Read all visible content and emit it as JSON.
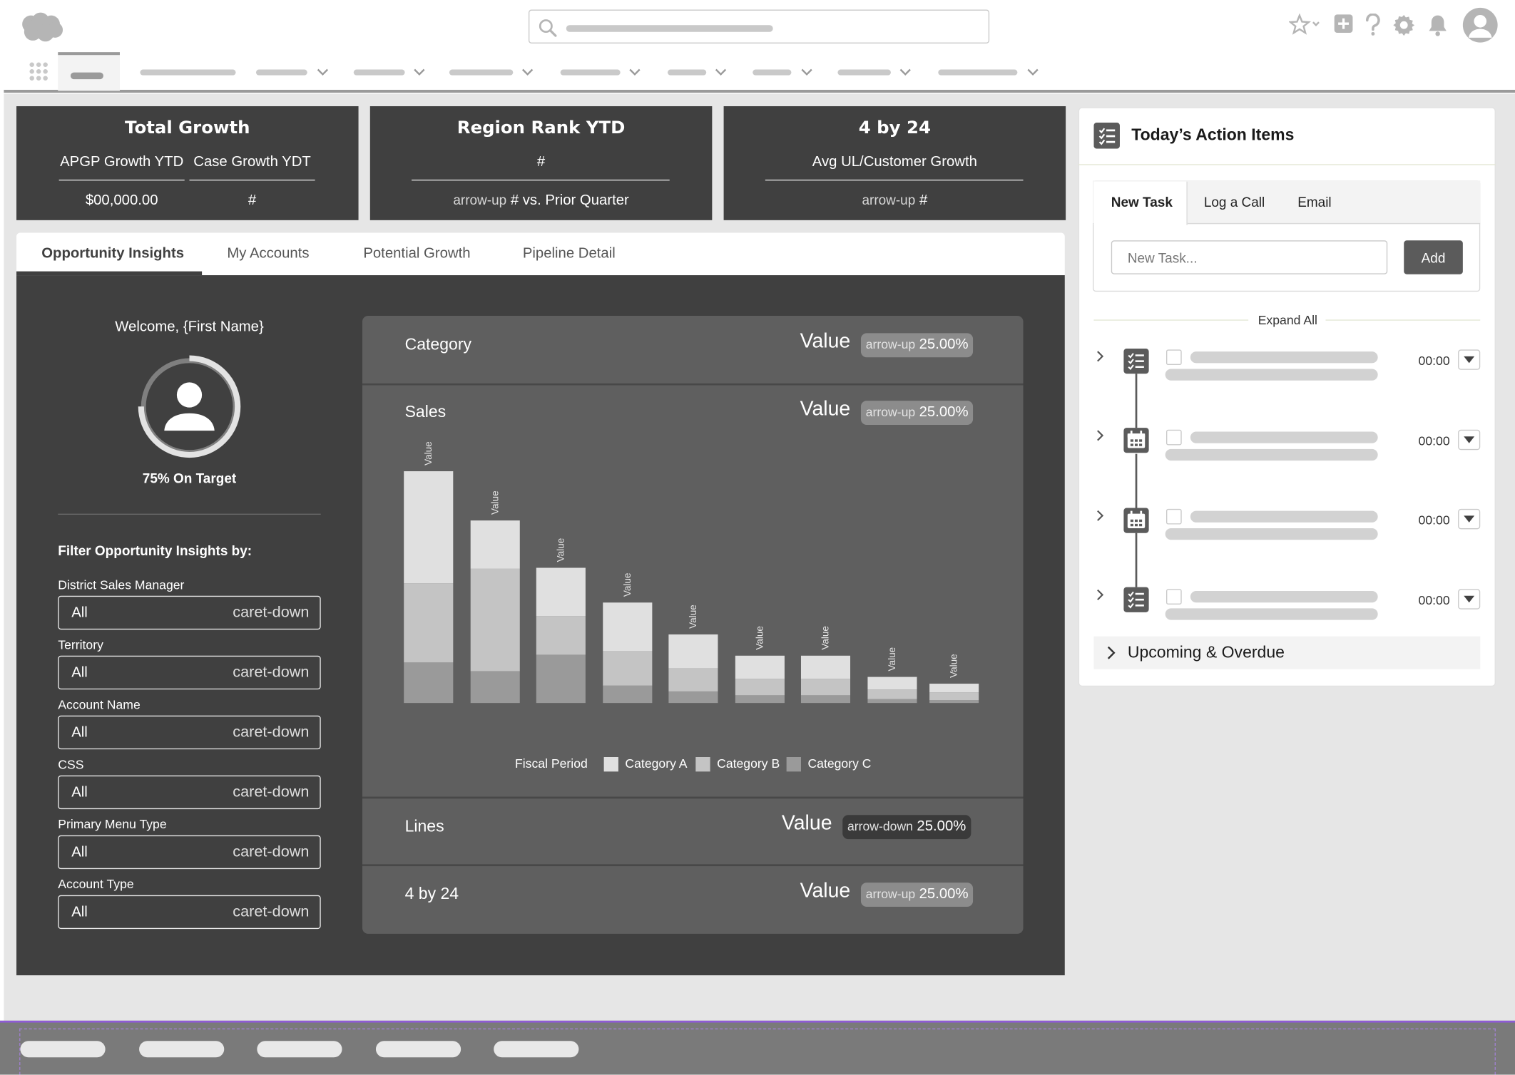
{
  "kpis": [
    {
      "title": "Total Growth",
      "sub_left": "APGP Growth YTD",
      "sub_right": "Case Growth YDT",
      "val_left": "$00,000.00",
      "val_right": "#"
    },
    {
      "title": "Region Rank YTD",
      "sub": "#",
      "arrow": "arrow-up",
      "val_mid": "#",
      "val_text": "vs. Prior Quarter"
    },
    {
      "title": "4 by 24",
      "sub": "Avg UL/Customer Growth",
      "arrow": "arrow-up",
      "val": "#"
    }
  ],
  "tabs": [
    "Opportunity Insights",
    "My Accounts",
    "Potential Growth",
    "Pipeline Detail"
  ],
  "left": {
    "welcome": "Welcome, {First Name}",
    "on_target": "75% On Target",
    "filter_head": "Filter Opportunity Insights by:",
    "filters": [
      {
        "label": "District Sales Manager",
        "value": "All",
        "caret": "caret-down"
      },
      {
        "label": "Territory",
        "value": "All",
        "caret": "caret-down"
      },
      {
        "label": "Account Name",
        "value": "All",
        "caret": "caret-down"
      },
      {
        "label": "CSS",
        "value": "All",
        "caret": "caret-down"
      },
      {
        "label": "Primary Menu Type",
        "value": "All",
        "caret": "caret-down"
      },
      {
        "label": "Account Type",
        "value": "All",
        "caret": "caret-down"
      }
    ]
  },
  "card": {
    "rows": [
      {
        "label": "Category",
        "value": "Value",
        "arrow": "arrow-up",
        "pct": "25.00%"
      },
      {
        "label": "Sales",
        "value": "Value",
        "arrow": "arrow-up",
        "pct": "25.00%"
      },
      {
        "label": "Lines",
        "value": "Value",
        "arrow": "arrow-down",
        "pct": "25.00%"
      },
      {
        "label": "4 by 24",
        "value": "Value",
        "arrow": "arrow-up",
        "pct": "25.00%"
      }
    ]
  },
  "chart_data": {
    "type": "bar",
    "stacked": true,
    "categories": [
      "",
      "",
      "",
      "",
      "",
      "",
      "",
      "",
      ""
    ],
    "bar_label": "Value",
    "xlabel": "Fiscal Period",
    "ylabel": "",
    "series": [
      {
        "name": "Category C",
        "color": "#9a9a9a",
        "values": [
          42,
          33,
          50,
          18,
          12,
          8,
          8,
          4,
          3
        ]
      },
      {
        "name": "Category B",
        "color": "#c4c4c4",
        "values": [
          82,
          106,
          40,
          36,
          24,
          17,
          17,
          10,
          8
        ]
      },
      {
        "name": "Category A",
        "color": "#e0e0e0",
        "values": [
          116,
          50,
          50,
          50,
          35,
          24,
          24,
          13,
          9
        ]
      }
    ]
  },
  "actions": {
    "title": "Today’s Action Items",
    "tabs": [
      "New Task",
      "Log a Call",
      "Email"
    ],
    "input_placeholder": "New Task...",
    "add_label": "Add",
    "expand_all": "Expand All",
    "items": [
      {
        "icon": "task-list-icon",
        "time": "00:00"
      },
      {
        "icon": "calendar-icon",
        "time": "00:00"
      },
      {
        "icon": "calendar-icon",
        "time": "00:00"
      },
      {
        "icon": "task-list-icon",
        "time": "00:00"
      }
    ],
    "upcoming": "Upcoming & Overdue"
  }
}
